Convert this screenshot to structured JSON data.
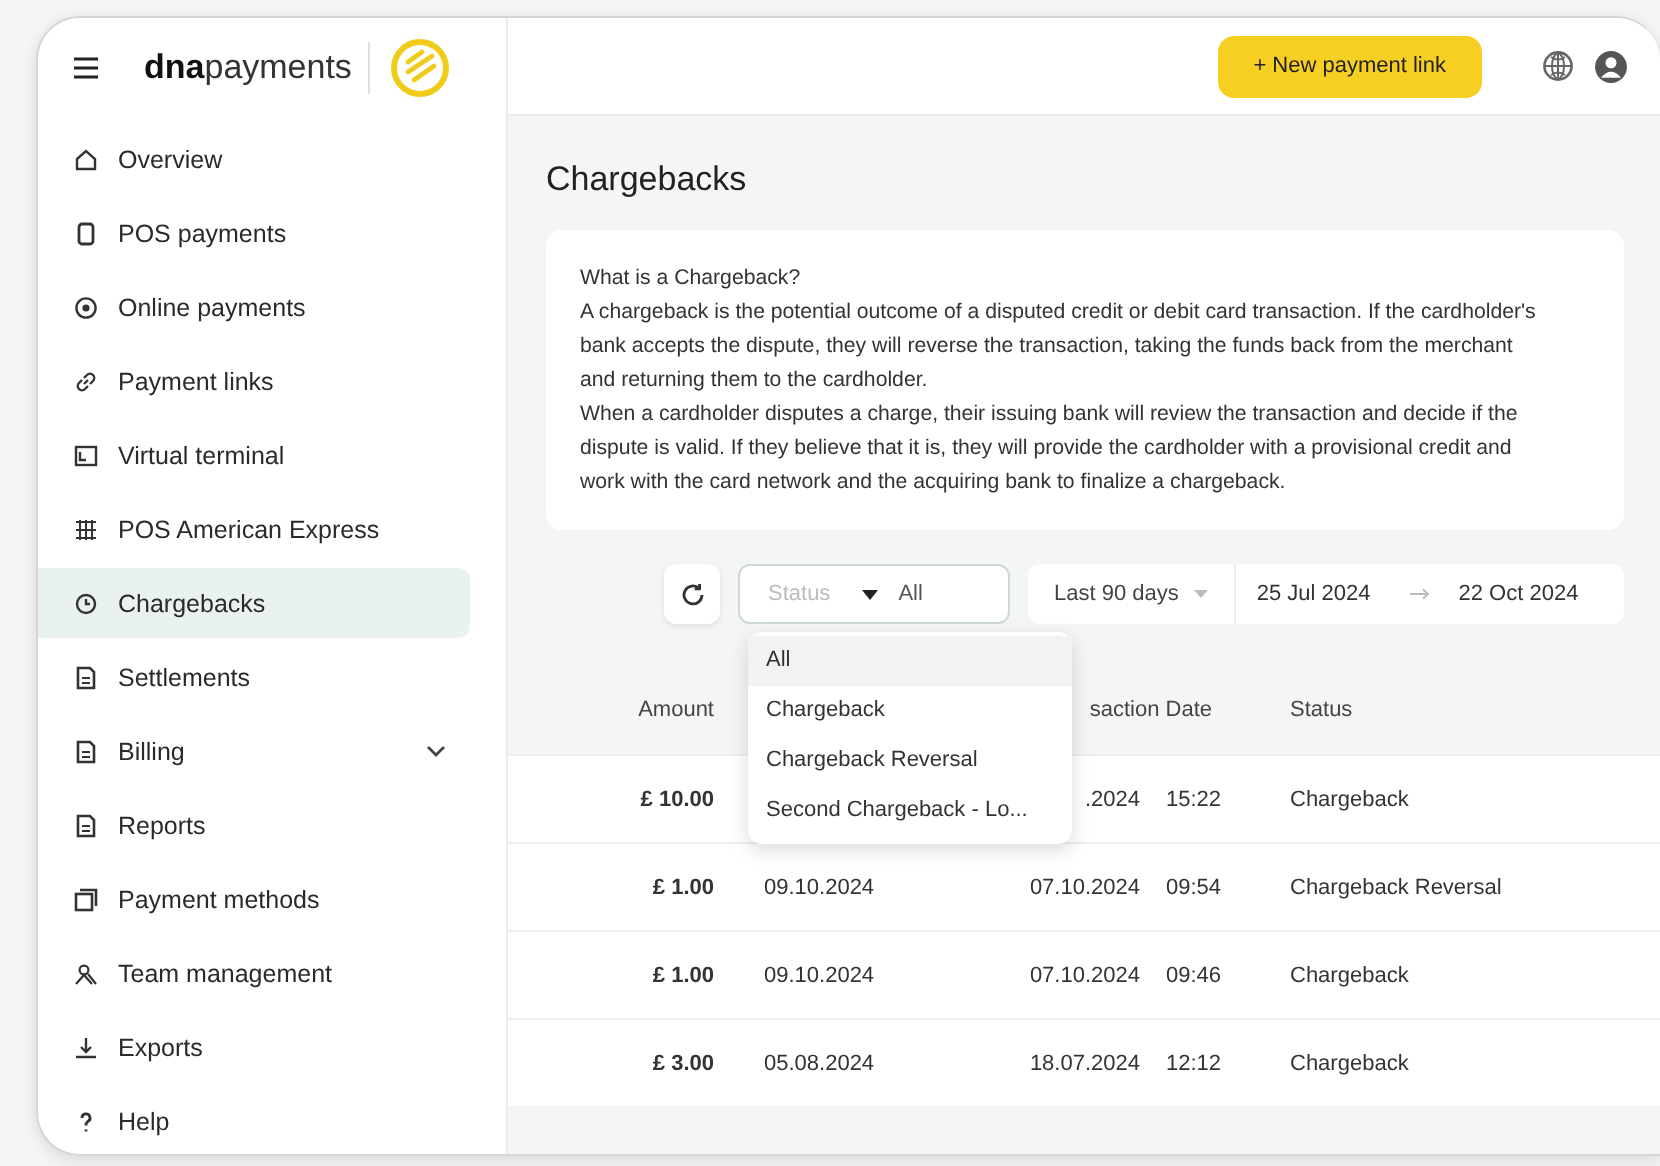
{
  "header": {
    "logo": {
      "bold": "dna",
      "light": "payments"
    },
    "new_link_button": "+ New payment link"
  },
  "sidebar": {
    "items": [
      {
        "label": "Overview",
        "selected": false
      },
      {
        "label": "POS payments",
        "selected": false
      },
      {
        "label": "Online payments",
        "selected": false
      },
      {
        "label": "Payment links",
        "selected": false
      },
      {
        "label": "Virtual terminal",
        "selected": false
      },
      {
        "label": "POS American Express",
        "selected": false
      },
      {
        "label": "Chargebacks",
        "selected": true
      },
      {
        "label": "Settlements",
        "selected": false
      },
      {
        "label": "Billing",
        "selected": false,
        "expanded": false
      },
      {
        "label": "Reports",
        "selected": false
      },
      {
        "label": "Payment methods",
        "selected": false
      },
      {
        "label": "Team management",
        "selected": false
      },
      {
        "label": "Exports",
        "selected": false
      },
      {
        "label": "Help",
        "selected": false
      }
    ]
  },
  "page": {
    "title": "Chargebacks"
  },
  "info": {
    "paragraphs": [
      "What is a Chargeback?",
      "A chargeback is the potential outcome of a disputed credit or debit card transaction. If the cardholder's bank accepts the dispute, they will reverse the transaction, taking the funds back from the merchant and returning them to the cardholder.",
      "When a cardholder disputes a charge, their issuing bank will review the transaction and decide if the dispute is valid. If they believe that it is, they will provide the cardholder with a provisional credit and work with the card network and the acquiring bank to finalize a chargeback."
    ]
  },
  "filters": {
    "status": {
      "label": "Status",
      "value": "All",
      "open": true,
      "options": [
        {
          "label": "All",
          "selected": true
        },
        {
          "label": "Chargeback",
          "selected": false
        },
        {
          "label": "Chargeback Reversal",
          "selected": false
        },
        {
          "label": "Second Chargeback - Lo...",
          "selected": false
        }
      ]
    },
    "range": {
      "preset": "Last 90 days",
      "from": "25 Jul 2024",
      "to": "22 Oct 2024"
    }
  },
  "table": {
    "headers": {
      "amount": "Amount",
      "transaction_date": "saction Date",
      "status": "Status"
    },
    "rows": [
      {
        "amount": "£ 10.00",
        "transaction_date": ".2024",
        "time": "15:22",
        "status": "Chargeback"
      },
      {
        "amount": "£ 1.00",
        "date": "09.10.2024",
        "transaction_date": "07.10.2024",
        "time": "09:54",
        "status": "Chargeback Reversal"
      },
      {
        "amount": "£ 1.00",
        "date": "09.10.2024",
        "transaction_date": "07.10.2024",
        "time": "09:46",
        "status": "Chargeback"
      },
      {
        "amount": "£ 3.00",
        "date": "05.08.2024",
        "transaction_date": "18.07.2024",
        "time": "12:12",
        "status": "Chargeback"
      }
    ]
  }
}
